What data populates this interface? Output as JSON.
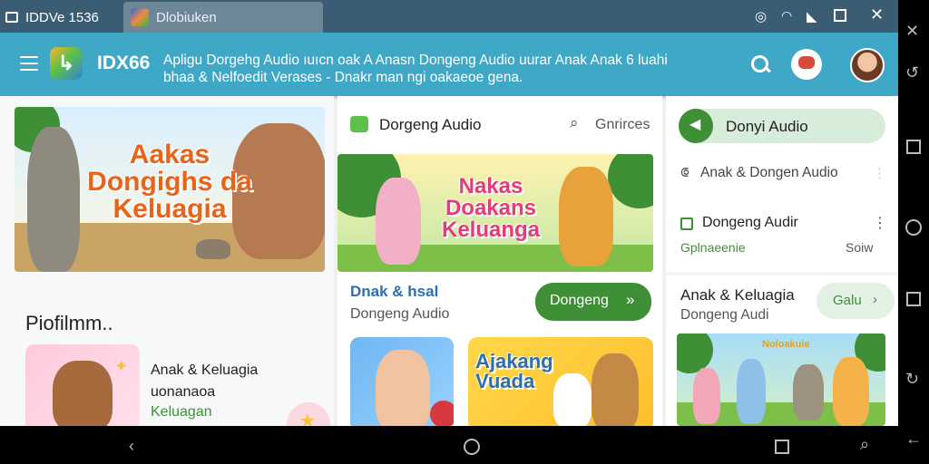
{
  "statusbar": {
    "tab1_label": "IDDVe 1536",
    "tab2_label": "Dlobiuken",
    "icons": [
      "circle-icon",
      "wifi-icon",
      "signal-icon",
      "window-icon",
      "close-icon"
    ]
  },
  "appbar": {
    "brand": "IDX66",
    "headline": "Apligu Dorgehg Audio ıuıcn  oak A Anasn Dongeng Audio uurar Anak Anak 6 luahi  bhaa & Nelfoedit Verases  -  Dnakr  man ngi oakaeoe gena."
  },
  "column1": {
    "hero_title": "Aakas Dongighs da Keluagia",
    "section_title": "Piofilmm..",
    "card_title": "Anak & Keluagia",
    "card_sub": "uonanaoa",
    "card_tag": "Keluagan"
  },
  "column2": {
    "header_title": "Dorgeng Audio",
    "header_action": "Gnrirces",
    "hero_title": "Nakas Doakans Keluanga",
    "item_title": "Dnak & hsal",
    "item_sub": "Dongeng Audio",
    "button_label": "Dongeng",
    "card2_title": "Ajakang Vuada"
  },
  "column3": {
    "pill_label": "Donyi Audio",
    "row1_label": "Anak & Dongen Audio",
    "row2_label": "Dongeng Audir",
    "row3_left": "Gplnaeenie",
    "row3_right": "Soiw",
    "card_title": "Anak & Keluagia",
    "card_sub": "Dongeng Audi",
    "card_button": "Galu",
    "card_banner": "Noloakuie"
  },
  "colors": {
    "statusbar": "#3a5d73",
    "appbar": "#3fa8c6",
    "accent_green": "#3f8f36",
    "title_blue": "#2a6fb0"
  }
}
